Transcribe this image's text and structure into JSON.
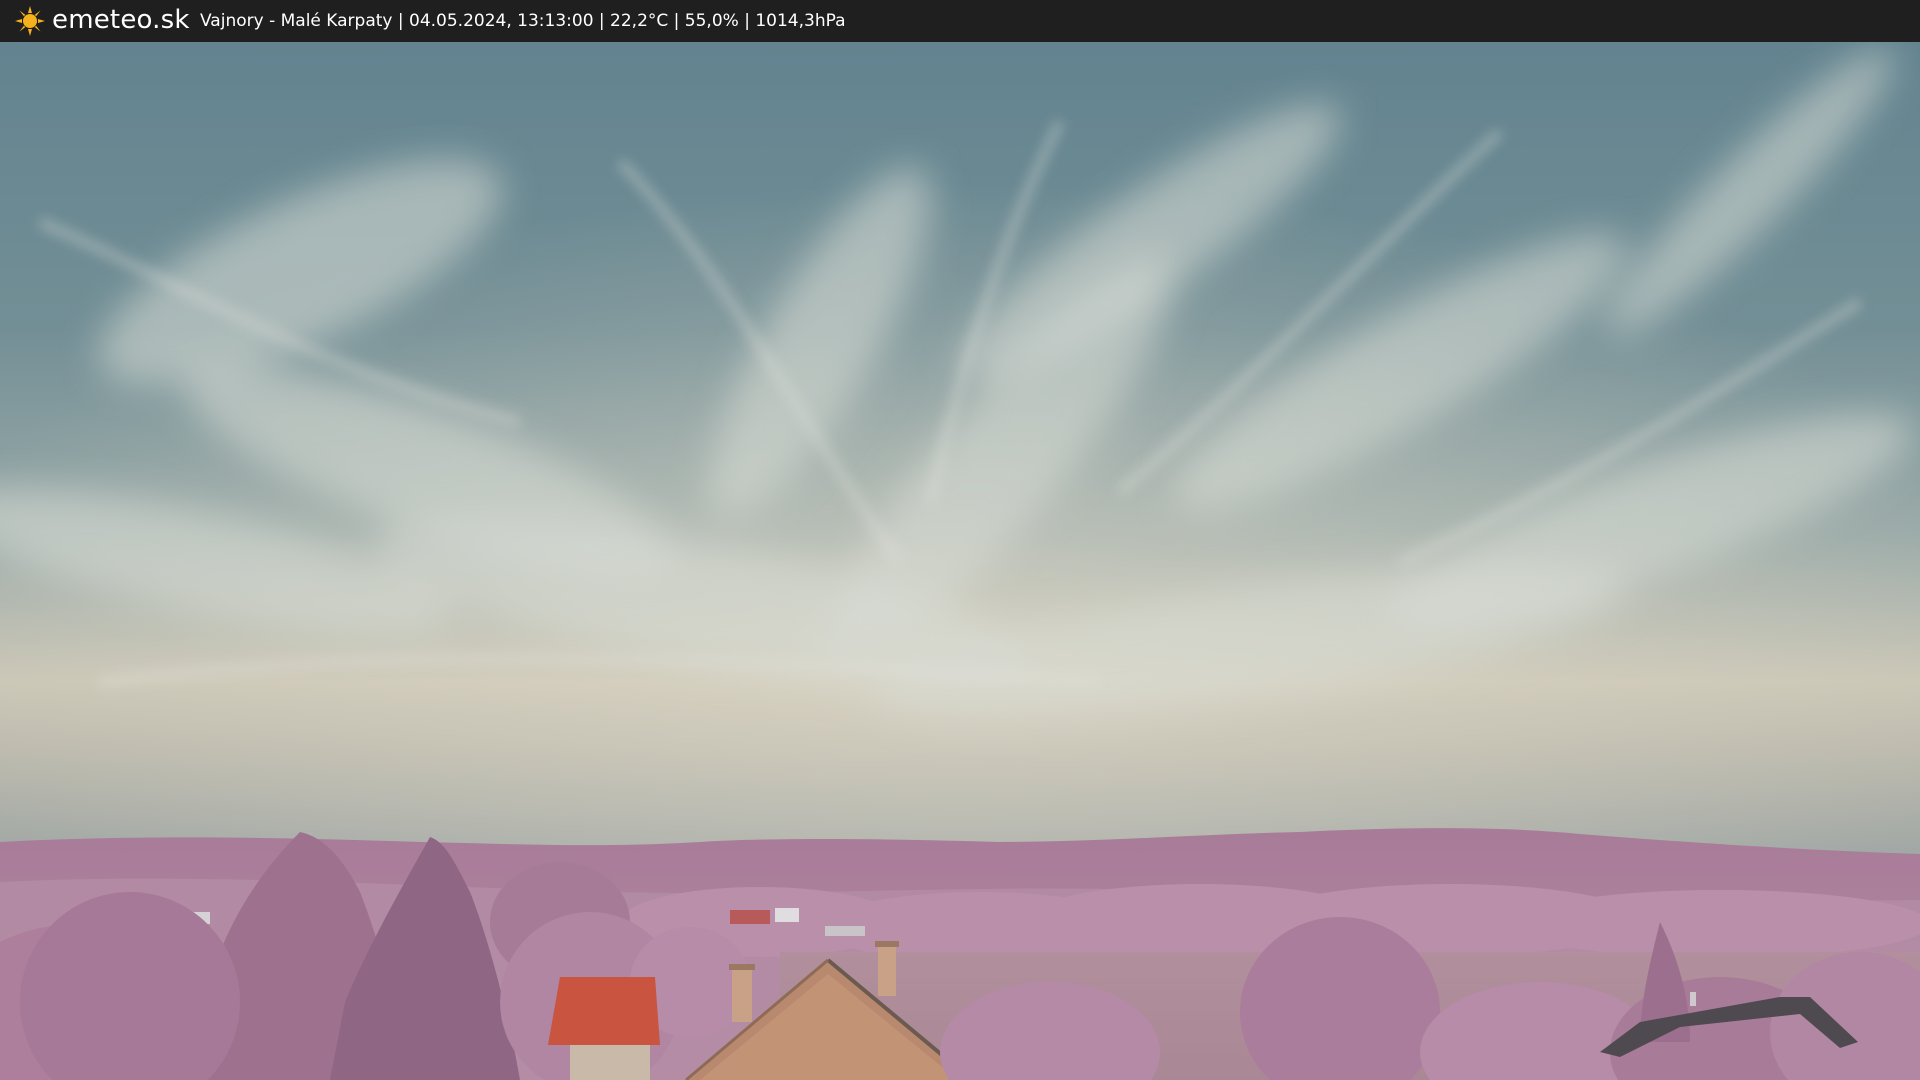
{
  "header": {
    "brand": "emeteo.sk",
    "caption": "Vajnory - Malé Karpaty | 04.05.2024, 13:13:00 | 22,2°C | 55,0% | 1014,3hPa",
    "logo_icon": "sun-icon"
  },
  "colors": {
    "bar": "#1f1f1f",
    "sun": "#f5b21c",
    "sky_top": "#6b8d98",
    "sky_horizon": "#d4cfbe",
    "vegetation": "#b88aa6",
    "roof": "#c9543f"
  }
}
